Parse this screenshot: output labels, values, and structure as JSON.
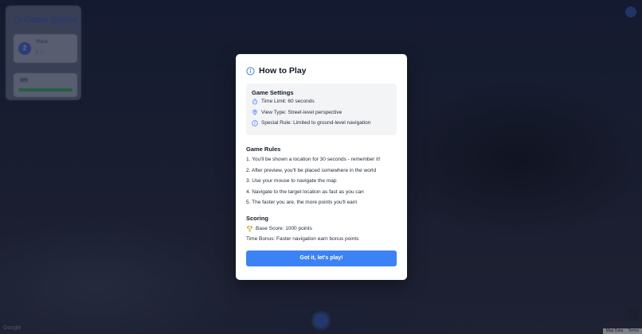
{
  "modal": {
    "title": "How to Play",
    "icon": "info-circle-icon",
    "accent_color": "#3b82f6",
    "settings": {
      "title": "Game Settings",
      "items": [
        {
          "icon": "timer-icon",
          "text": "Time Limit: 60 seconds"
        },
        {
          "icon": "map-pin-icon",
          "text": "View Type: Street-level perspective"
        },
        {
          "icon": "info-circle-icon",
          "text": "Special Rule: Limited to ground-level navigation"
        }
      ]
    },
    "rules": {
      "title": "Game Rules",
      "items": [
        "1. You'll be shown a location for 30 seconds - remember it!",
        "2. After preview, you'll be placed somewhere in the world",
        "3. Use your mouse to navigate the map",
        "4. Navigate to the target location as fast as you can",
        "5. The faster you are, the more points you'll earn"
      ]
    },
    "scoring": {
      "title": "Scoring",
      "base_score": "Base Score: 1000 points",
      "base_score_icon": "trophy-icon",
      "time_bonus": "Time Bonus: Faster navigation earn bonus points"
    },
    "play_button": "Got it, let's play!"
  },
  "background": {
    "status_card_title": "Game Status",
    "player_avatar": "2",
    "player_name": "Place",
    "player_sub": "1 ✓",
    "progress_label": "0/5",
    "google_logo": "Google",
    "footer": [
      "Map Data",
      "Terms"
    ]
  }
}
